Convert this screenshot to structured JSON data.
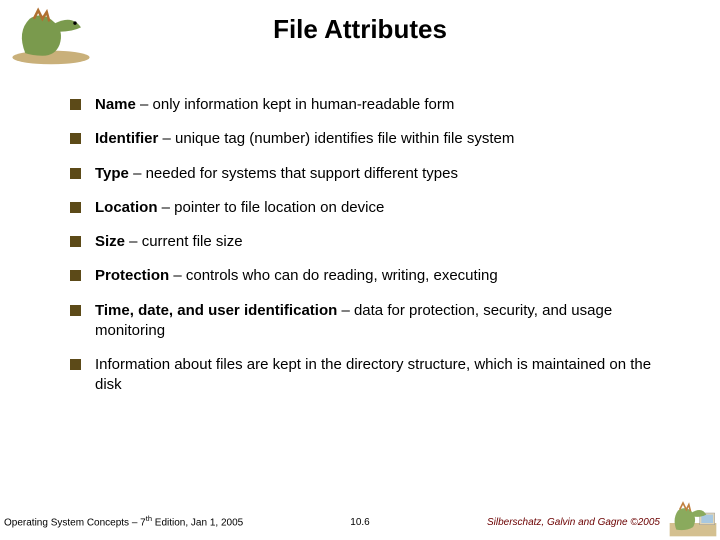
{
  "title": "File Attributes",
  "items": [
    {
      "bold": "Name",
      "rest": " – only information kept in human-readable form"
    },
    {
      "bold": "Identifier",
      "rest": " – unique tag (number) identifies file within file system"
    },
    {
      "bold": "Type",
      "rest": " – needed for systems that support different types"
    },
    {
      "bold": "Location",
      "rest": " – pointer to file location on device"
    },
    {
      "bold": "Size",
      "rest": " – current file size"
    },
    {
      "bold": "Protection",
      "rest": " – controls who can do reading, writing, executing"
    },
    {
      "bold": "Time, date, and user identification",
      "rest": " – data for protection, security, and usage monitoring"
    },
    {
      "bold": "",
      "rest": "Information about files are kept in the directory structure, which is maintained on the disk"
    }
  ],
  "footer": {
    "left_a": "Operating System Concepts – 7",
    "left_sup": "th",
    "left_b": " Edition, Jan 1, 2005",
    "center": "10.6",
    "right": "Silberschatz, Galvin and Gagne ©2005"
  }
}
